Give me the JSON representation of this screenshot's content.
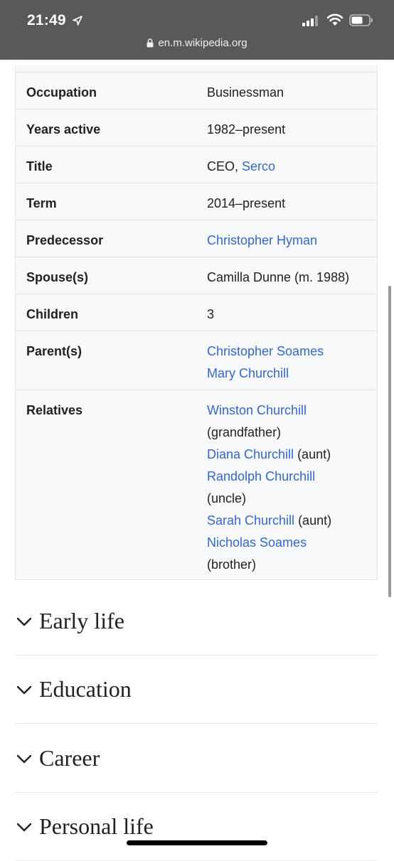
{
  "status": {
    "time": "21:49",
    "url": "en.m.wikipedia.org"
  },
  "infobox": {
    "rows": [
      {
        "label": "Occupation",
        "lines": [
          [
            {
              "text": "Businessman",
              "link": false
            }
          ]
        ]
      },
      {
        "label": "Years active",
        "lines": [
          [
            {
              "text": "1982–present",
              "link": false
            }
          ]
        ]
      },
      {
        "label": "Title",
        "lines": [
          [
            {
              "text": "CEO, ",
              "link": false
            },
            {
              "text": "Serco",
              "link": true
            }
          ]
        ]
      },
      {
        "label": "Term",
        "lines": [
          [
            {
              "text": "2014–present",
              "link": false
            }
          ]
        ]
      },
      {
        "label": "Predecessor",
        "lines": [
          [
            {
              "text": "Christopher Hyman",
              "link": true
            }
          ]
        ]
      },
      {
        "label": "Spouse(s)",
        "lines": [
          [
            {
              "text": "Camilla Dunne (m. 1988)",
              "link": false
            }
          ]
        ]
      },
      {
        "label": "Children",
        "lines": [
          [
            {
              "text": "3",
              "link": false
            }
          ]
        ]
      },
      {
        "label": "Parent(s)",
        "lines": [
          [
            {
              "text": "Christopher Soames",
              "link": true
            }
          ],
          [
            {
              "text": "Mary Churchill",
              "link": true
            }
          ]
        ]
      },
      {
        "label": "Relatives",
        "lines": [
          [
            {
              "text": "Winston Churchill",
              "link": true
            }
          ],
          [
            {
              "text": "(grandfather)",
              "link": false
            }
          ],
          [
            {
              "text": "Diana Churchill",
              "link": true
            },
            {
              "text": " (aunt)",
              "link": false
            }
          ],
          [
            {
              "text": "Randolph Churchill",
              "link": true
            }
          ],
          [
            {
              "text": "(uncle)",
              "link": false
            }
          ],
          [
            {
              "text": "Sarah Churchill",
              "link": true
            },
            {
              "text": " (aunt)",
              "link": false
            }
          ],
          [
            {
              "text": "Nicholas Soames",
              "link": true
            }
          ],
          [
            {
              "text": "(brother)",
              "link": false
            }
          ]
        ]
      }
    ]
  },
  "sections": [
    {
      "title": "Early life"
    },
    {
      "title": "Education"
    },
    {
      "title": "Career"
    },
    {
      "title": "Personal life"
    }
  ],
  "colors": {
    "link": "#3366cc",
    "statusbar": "#59595a",
    "infobox_bg": "#f8f9fa"
  }
}
